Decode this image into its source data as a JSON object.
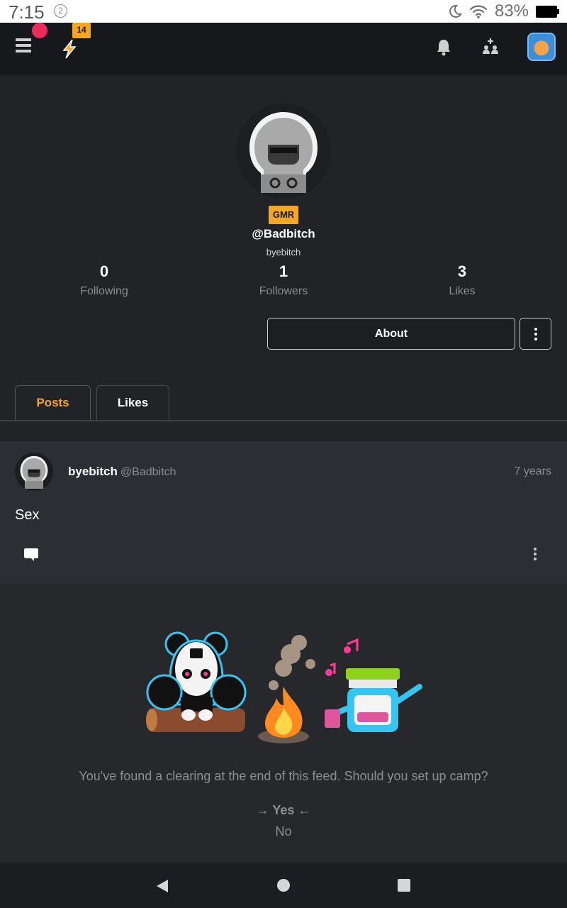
{
  "status_bar": {
    "time": "7:15",
    "notification_count": "2",
    "battery": "83%",
    "icons": [
      "moon-icon",
      "wifi-icon",
      "battery-icon"
    ]
  },
  "app_bar": {
    "bolt_badge": "14",
    "icons": [
      "menu-icon",
      "bolt-icon",
      "bell-icon",
      "people-icon",
      "user-avatar"
    ],
    "accent": "#f5a623",
    "dot_color": "#ec2b5b"
  },
  "profile": {
    "badge": "GMR",
    "handle": "@Badbitch",
    "username": "byebitch",
    "stats": [
      {
        "value": "0",
        "label": "Following"
      },
      {
        "value": "1",
        "label": "Followers"
      },
      {
        "value": "3",
        "label": "Likes"
      }
    ],
    "about_label": "About"
  },
  "tabs": [
    {
      "label": "Posts",
      "active": true
    },
    {
      "label": "Likes",
      "active": false
    }
  ],
  "post": {
    "author_name": "byebitch",
    "author_handle": "@Badbitch",
    "time": "7 years",
    "text": "Sex"
  },
  "feed_end": {
    "message": "You've found a clearing at the end of this feed. Should you set up camp?",
    "yes_label": "Yes",
    "no_label": "No"
  },
  "nav": {
    "icons": [
      "back-icon",
      "home-icon",
      "recents-icon"
    ]
  }
}
